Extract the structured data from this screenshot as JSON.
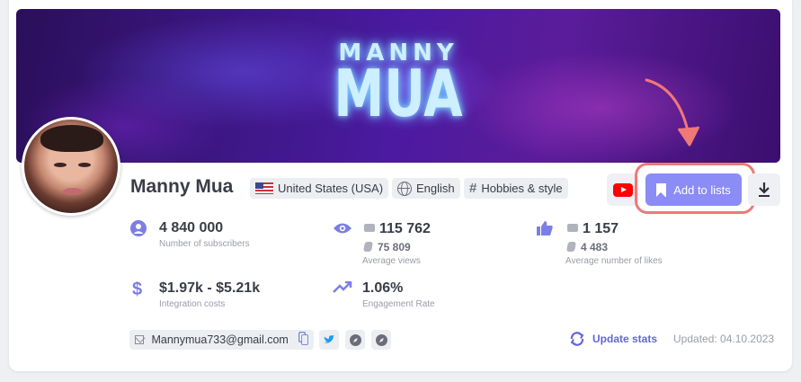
{
  "banner": {
    "brand_top": "MANNY",
    "brand_main": "MUA"
  },
  "profile": {
    "name": "Manny Mua",
    "tags": [
      {
        "label": "United States (USA)",
        "icon": "us-flag-icon"
      },
      {
        "label": "English",
        "icon": "globe-icon"
      },
      {
        "label": "Hobbies & style",
        "icon": "hashtag-icon"
      }
    ]
  },
  "actions": {
    "add_to_lists": "Add to lists"
  },
  "stats": {
    "subscribers": {
      "value": "4 840 000",
      "caption": "Number of subscribers"
    },
    "views": {
      "value": "115 762",
      "shorts": "75 809",
      "caption": "Average views"
    },
    "likes": {
      "value": "1 157",
      "shorts": "4 483",
      "caption": "Average number of likes"
    },
    "integration": {
      "value": "$1.97k - $5.21k",
      "caption": "Integration costs"
    },
    "engagement": {
      "value": "1.06%",
      "caption": "Engagement Rate"
    }
  },
  "contacts": {
    "email": "Mannymua733@gmail.com",
    "social": [
      "twitter-icon",
      "compass-icon",
      "compass-icon"
    ]
  },
  "footer": {
    "update_label": "Update stats",
    "updated_text": "Updated: 04.10.2023"
  },
  "colors": {
    "accent": "#8b8cf6",
    "link": "#6166e0",
    "highlight": "#f07878",
    "youtube": "#ff0000"
  }
}
